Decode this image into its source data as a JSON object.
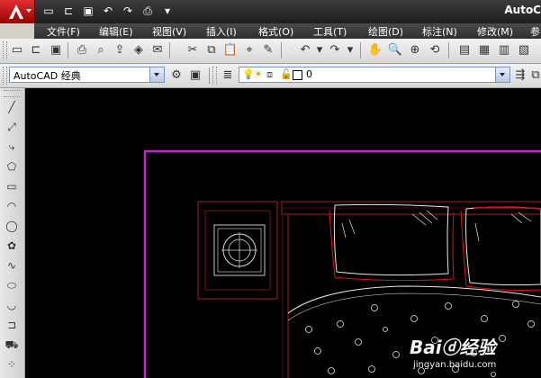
{
  "window": {
    "title": "AutoC"
  },
  "quick_access": {
    "icons": [
      "new-icon",
      "open-icon",
      "save-icon",
      "undo-icon",
      "redo-icon",
      "plot-icon",
      "dropdown-icon"
    ]
  },
  "menus": [
    {
      "label": "文件(F)"
    },
    {
      "label": "编辑(E)"
    },
    {
      "label": "视图(V)"
    },
    {
      "label": "插入(I)"
    },
    {
      "label": "格式(O)"
    },
    {
      "label": "工具(T)"
    },
    {
      "label": "绘图(D)"
    },
    {
      "label": "标注(N)"
    },
    {
      "label": "修改(M)"
    },
    {
      "label": "参"
    }
  ],
  "workspace": {
    "selected": "AutoCAD 经典"
  },
  "layer": {
    "selected": "0"
  },
  "watermark": {
    "logo": "Baiⓓ经验",
    "url": "jingyan.baidu.com"
  },
  "colors": {
    "canvas_bg": "#000000",
    "border_line": "#cc22cc",
    "furniture_line": "#8b1a1a",
    "bright_red": "#e01010",
    "pattern_line": "#e8e8e8"
  }
}
